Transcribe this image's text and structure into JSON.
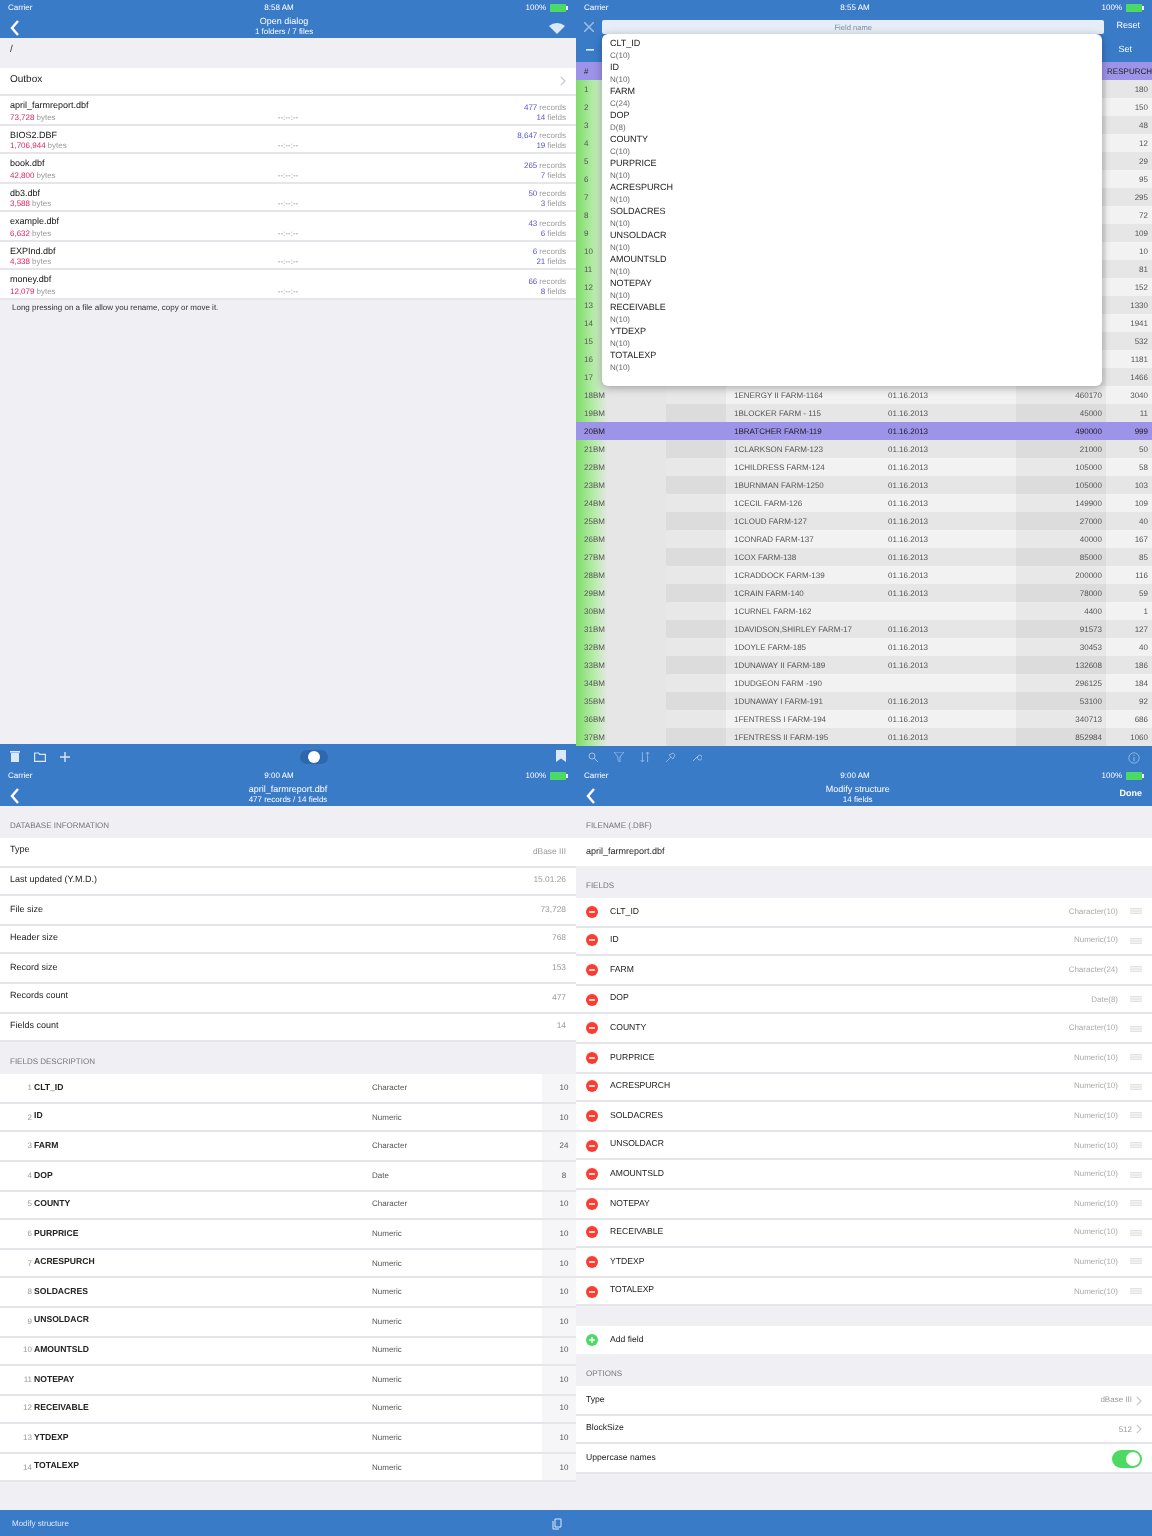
{
  "open_dialog": {
    "status_bar": {
      "carrier": "Carrier",
      "time": "8:58 AM",
      "battery": "100%"
    },
    "title": "Open dialog",
    "subtitle": "1 folders / 7 files",
    "path": "/",
    "folder": "Outbox",
    "files": [
      {
        "name": "april_farmreport.dbf",
        "bytes": "73,728",
        "bytes_label": "bytes",
        "date": "--:--:--",
        "records": "477",
        "records_label": "records",
        "fields": "14",
        "fields_label": "fields"
      },
      {
        "name": "BIOS2.DBF",
        "bytes": "1,706,944",
        "bytes_label": "bytes",
        "date": "--:--:--",
        "records": "8,647",
        "records_label": "records",
        "fields": "19",
        "fields_label": "fields"
      },
      {
        "name": "book.dbf",
        "bytes": "42,800",
        "bytes_label": "bytes",
        "date": "--:--:--",
        "records": "265",
        "records_label": "records",
        "fields": "7",
        "fields_label": "fields"
      },
      {
        "name": "db3.dbf",
        "bytes": "3,588",
        "bytes_label": "bytes",
        "date": "--:--:--",
        "records": "50",
        "records_label": "records",
        "fields": "3",
        "fields_label": "fields"
      },
      {
        "name": "example.dbf",
        "bytes": "6,632",
        "bytes_label": "bytes",
        "date": "--:--:--",
        "records": "43",
        "records_label": "records",
        "fields": "6",
        "fields_label": "fields"
      },
      {
        "name": "EXPInd.dbf",
        "bytes": "4,338",
        "bytes_label": "bytes",
        "date": "--:--:--",
        "records": "6",
        "records_label": "records",
        "fields": "21",
        "fields_label": "fields"
      },
      {
        "name": "money.dbf",
        "bytes": "12,079",
        "bytes_label": "bytes",
        "date": "--:--:--",
        "records": "66",
        "records_label": "records",
        "fields": "8",
        "fields_label": "fields"
      }
    ],
    "hint": "Long pressing on a file allow you rename, copy or move it."
  },
  "table_view": {
    "status_bar": {
      "carrier": "Carrier",
      "time": "8:55 AM",
      "battery": "100%"
    },
    "search": {
      "placeholder": "Field name"
    },
    "reset": "Reset",
    "set": "Set",
    "columns": [
      "#",
      "RESPURCH"
    ],
    "rows": [
      {
        "id": "1",
        "farm": "",
        "date": "",
        "price": "",
        "acres": "180",
        "selected": false
      },
      {
        "id": "2",
        "farm": "",
        "date": "",
        "price": "",
        "acres": "150",
        "selected": false
      },
      {
        "id": "3",
        "farm": "",
        "date": "",
        "price": "",
        "acres": "48",
        "selected": false
      },
      {
        "id": "4",
        "farm": "",
        "date": "",
        "price": "",
        "acres": "12",
        "selected": false
      },
      {
        "id": "5",
        "farm": "",
        "date": "",
        "price": "",
        "acres": "29",
        "selected": false
      },
      {
        "id": "6",
        "farm": "",
        "date": "",
        "price": "",
        "acres": "95",
        "selected": false
      },
      {
        "id": "7",
        "farm": "",
        "date": "",
        "price": "",
        "acres": "295",
        "selected": false
      },
      {
        "id": "8",
        "farm": "",
        "date": "",
        "price": "",
        "acres": "72",
        "selected": false
      },
      {
        "id": "9",
        "farm": "",
        "date": "",
        "price": "",
        "acres": "109",
        "selected": false
      },
      {
        "id": "10",
        "farm": "",
        "date": "",
        "price": "",
        "acres": "10",
        "selected": false
      },
      {
        "id": "11",
        "farm": "",
        "date": "",
        "price": "",
        "acres": "81",
        "selected": false
      },
      {
        "id": "12",
        "farm": "",
        "date": "",
        "price": "",
        "acres": "152",
        "selected": false
      },
      {
        "id": "13",
        "farm": "",
        "date": "",
        "price": "",
        "acres": "1330",
        "selected": false
      },
      {
        "id": "14",
        "farm": "",
        "date": "",
        "price": "",
        "acres": "1941",
        "selected": false
      },
      {
        "id": "15",
        "farm": "",
        "date": "",
        "price": "",
        "acres": "532",
        "selected": false
      },
      {
        "id": "16",
        "farm": "",
        "date": "",
        "price": "",
        "acres": "1181",
        "selected": false
      },
      {
        "id": "17",
        "farm": "",
        "date": "",
        "price": "",
        "acres": "1466",
        "selected": false
      },
      {
        "id": "18BM",
        "farm": "1ENERGY II FARM-1164",
        "date": "01.16.2013",
        "price": "460170",
        "acres": "3040",
        "selected": false
      },
      {
        "id": "19BM",
        "farm": "1BLOCKER FARM - 115",
        "date": "01.16.2013",
        "price": "45000",
        "acres": "11",
        "selected": false
      },
      {
        "id": "20BM",
        "farm": "1BRATCHER FARM-119",
        "date": "01.16.2013",
        "price": "490000",
        "acres": "999",
        "selected": true
      },
      {
        "id": "21BM",
        "farm": "1CLARKSON FARM-123",
        "date": "01.16.2013",
        "price": "21000",
        "acres": "50",
        "selected": false
      },
      {
        "id": "22BM",
        "farm": "1CHILDRESS FARM-124",
        "date": "01.16.2013",
        "price": "105000",
        "acres": "58",
        "selected": false
      },
      {
        "id": "23BM",
        "farm": "1BURNMAN FARM-1250",
        "date": "01.16.2013",
        "price": "105000",
        "acres": "103",
        "selected": false
      },
      {
        "id": "24BM",
        "farm": "1CECIL FARM-126",
        "date": "01.16.2013",
        "price": "149900",
        "acres": "109",
        "selected": false
      },
      {
        "id": "25BM",
        "farm": "1CLOUD FARM-127",
        "date": "01.16.2013",
        "price": "27000",
        "acres": "40",
        "selected": false
      },
      {
        "id": "26BM",
        "farm": "1CONRAD FARM-137",
        "date": "01.16.2013",
        "price": "40000",
        "acres": "167",
        "selected": false
      },
      {
        "id": "27BM",
        "farm": "1COX FARM-138",
        "date": "01.16.2013",
        "price": "85000",
        "acres": "85",
        "selected": false
      },
      {
        "id": "28BM",
        "farm": "1CRADDOCK FARM-139",
        "date": "01.16.2013",
        "price": "200000",
        "acres": "116",
        "selected": false
      },
      {
        "id": "29BM",
        "farm": "1CRAIN FARM-140",
        "date": "01.16.2013",
        "price": "78000",
        "acres": "59",
        "selected": false
      },
      {
        "id": "30BM",
        "farm": "1CURNEL FARM-162",
        "date": "",
        "price": "4400",
        "acres": "1",
        "selected": false
      },
      {
        "id": "31BM",
        "farm": "1DAVIDSON,SHIRLEY FARM-17",
        "date": "01.16.2013",
        "price": "91573",
        "acres": "127",
        "selected": false
      },
      {
        "id": "32BM",
        "farm": "1DOYLE FARM-185",
        "date": "01.16.2013",
        "price": "30453",
        "acres": "40",
        "selected": false
      },
      {
        "id": "33BM",
        "farm": "1DUNAWAY II FARM-189",
        "date": "01.16.2013",
        "price": "132608",
        "acres": "186",
        "selected": false
      },
      {
        "id": "34BM",
        "farm": "1DUDGEON FARM -190",
        "date": "",
        "price": "296125",
        "acres": "184",
        "selected": false
      },
      {
        "id": "35BM",
        "farm": "1DUNAWAY I FARM-191",
        "date": "01.16.2013",
        "price": "53100",
        "acres": "92",
        "selected": false
      },
      {
        "id": "36BM",
        "farm": "1FENTRESS I FARM-194",
        "date": "01.16.2013",
        "price": "340713",
        "acres": "686",
        "selected": false
      },
      {
        "id": "37BM",
        "farm": "1FENTRESS II FARM-195",
        "date": "01.16.2013",
        "price": "852984",
        "acres": "1060",
        "selected": false
      }
    ],
    "field_menu": [
      {
        "name": "CLT_ID",
        "type": "C(10)"
      },
      {
        "name": "ID",
        "type": "N(10)"
      },
      {
        "name": "FARM",
        "type": "C(24)"
      },
      {
        "name": "DOP",
        "type": "D(8)"
      },
      {
        "name": "COUNTY",
        "type": "C(10)"
      },
      {
        "name": "PURPRICE",
        "type": "N(10)"
      },
      {
        "name": "ACRESPURCH",
        "type": "N(10)"
      },
      {
        "name": "SOLDACRES",
        "type": "N(10)"
      },
      {
        "name": "UNSOLDACR",
        "type": "N(10)"
      },
      {
        "name": "AMOUNTSLD",
        "type": "N(10)"
      },
      {
        "name": "NOTEPAY",
        "type": "N(10)"
      },
      {
        "name": "RECEIVABLE",
        "type": "N(10)"
      },
      {
        "name": "YTDEXP",
        "type": "N(10)"
      },
      {
        "name": "TOTALEXP",
        "type": "N(10)"
      }
    ]
  },
  "info_view": {
    "status_bar": {
      "carrier": "Carrier",
      "time": "9:00 AM",
      "battery": "100%"
    },
    "title": "april_farmreport.dbf",
    "subtitle": "477 records / 14 fields",
    "info_header": "DATABASE INFORMATION",
    "info": [
      {
        "label": "Type",
        "value": "dBase III"
      },
      {
        "label": "Last updated (Y.M.D.)",
        "value": "15.01.26"
      },
      {
        "label": "File size",
        "value": "73,728"
      },
      {
        "label": "Header size",
        "value": "768"
      },
      {
        "label": "Record size",
        "value": "153"
      },
      {
        "label": "Records count",
        "value": "477"
      },
      {
        "label": "Fields count",
        "value": "14"
      }
    ],
    "fields_header": "FIELDS DESCRIPTION",
    "fields": [
      {
        "index": "1",
        "name": "CLT_ID",
        "type": "Character",
        "size": "10"
      },
      {
        "index": "2",
        "name": "ID",
        "type": "Numeric",
        "size": "10"
      },
      {
        "index": "3",
        "name": "FARM",
        "type": "Character",
        "size": "24"
      },
      {
        "index": "4",
        "name": "DOP",
        "type": "Date",
        "size": "8"
      },
      {
        "index": "5",
        "name": "COUNTY",
        "type": "Character",
        "size": "10"
      },
      {
        "index": "6",
        "name": "PURPRICE",
        "type": "Numeric",
        "size": "10"
      },
      {
        "index": "7",
        "name": "ACRESPURCH",
        "type": "Numeric",
        "size": "10"
      },
      {
        "index": "8",
        "name": "SOLDACRES",
        "type": "Numeric",
        "size": "10"
      },
      {
        "index": "9",
        "name": "UNSOLDACR",
        "type": "Numeric",
        "size": "10"
      },
      {
        "index": "10",
        "name": "AMOUNTSLD",
        "type": "Numeric",
        "size": "10"
      },
      {
        "index": "11",
        "name": "NOTEPAY",
        "type": "Numeric",
        "size": "10"
      },
      {
        "index": "12",
        "name": "RECEIVABLE",
        "type": "Numeric",
        "size": "10"
      },
      {
        "index": "13",
        "name": "YTDEXP",
        "type": "Numeric",
        "size": "10"
      },
      {
        "index": "14",
        "name": "TOTALEXP",
        "type": "Numeric",
        "size": "10"
      }
    ],
    "modify": "Modify structure"
  },
  "modify_view": {
    "status_bar": {
      "carrier": "Carrier",
      "time": "9:00 AM",
      "battery": "100%"
    },
    "title": "Modify structure",
    "subtitle": "14 fields",
    "done": "Done",
    "filename_header": "FILENAME (.DBF)",
    "filename": "april_farmreport.dbf",
    "fields_header": "FIELDS",
    "fields": [
      {
        "name": "CLT_ID",
        "type": "Character(10)"
      },
      {
        "name": "ID",
        "type": "Numeric(10)"
      },
      {
        "name": "FARM",
        "type": "Character(24)"
      },
      {
        "name": "DOP",
        "type": "Date(8)"
      },
      {
        "name": "COUNTY",
        "type": "Character(10)"
      },
      {
        "name": "PURPRICE",
        "type": "Numeric(10)"
      },
      {
        "name": "ACRESPURCH",
        "type": "Numeric(10)"
      },
      {
        "name": "SOLDACRES",
        "type": "Numeric(10)"
      },
      {
        "name": "UNSOLDACR",
        "type": "Numeric(10)"
      },
      {
        "name": "AMOUNTSLD",
        "type": "Numeric(10)"
      },
      {
        "name": "NOTEPAY",
        "type": "Numeric(10)"
      },
      {
        "name": "RECEIVABLE",
        "type": "Numeric(10)"
      },
      {
        "name": "YTDEXP",
        "type": "Numeric(10)"
      },
      {
        "name": "TOTALEXP",
        "type": "Numeric(10)"
      }
    ],
    "add_field": "Add field",
    "options_header": "OPTIONS",
    "options": [
      {
        "kind": "choice",
        "label": "Type",
        "value": "dBase III"
      },
      {
        "kind": "choice",
        "label": "BlockSize",
        "value": "512"
      },
      {
        "kind": "switch",
        "label": "Uppercase names",
        "on": true
      }
    ]
  }
}
